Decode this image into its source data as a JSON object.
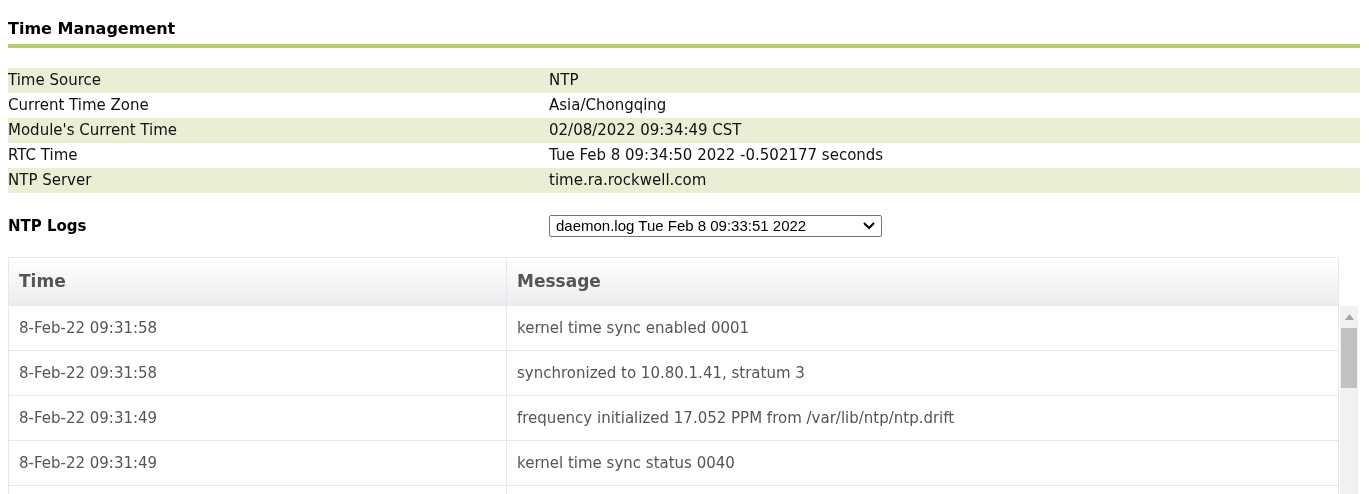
{
  "title": "Time Management",
  "info": [
    {
      "label": "Time Source",
      "value": "NTP"
    },
    {
      "label": "Current Time Zone",
      "value": "Asia/Chongqing"
    },
    {
      "label": "Module's Current Time",
      "value": "02/08/2022 09:34:49 CST"
    },
    {
      "label": "RTC Time",
      "value": "Tue Feb 8 09:34:50 2022 -0.502177 seconds"
    },
    {
      "label": "NTP Server",
      "value": "time.ra.rockwell.com"
    }
  ],
  "logs": {
    "label": "NTP Logs",
    "select_value": "daemon.log Tue Feb 8 09:33:51 2022"
  },
  "table": {
    "columns": [
      "Time",
      "Message"
    ],
    "rows": [
      [
        "8-Feb-22 09:31:58",
        "kernel time sync enabled 0001"
      ],
      [
        "8-Feb-22 09:31:58",
        "synchronized to 10.80.1.41, stratum 3"
      ],
      [
        "8-Feb-22 09:31:49",
        "frequency initialized 17.052 PPM from /var/lib/ntp/ntp.drift"
      ],
      [
        "8-Feb-22 09:31:49",
        "kernel time sync status 0040"
      ]
    ]
  }
}
